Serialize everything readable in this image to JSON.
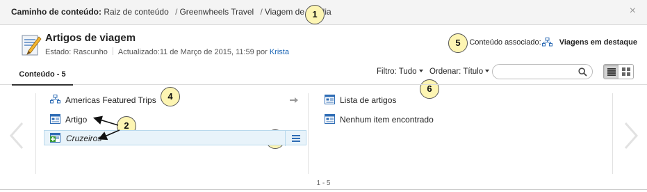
{
  "path": {
    "label": "Caminho de conteúdo:",
    "root": "Raiz de conteúdo",
    "segments": [
      "Greenwheels Travel",
      "Viagem de família"
    ],
    "separator": "/"
  },
  "close_label": "×",
  "callouts": [
    "1",
    "2",
    "3",
    "4",
    "5",
    "6"
  ],
  "header": {
    "title": "Artigos de viagem",
    "status": "Estado: Rascunho",
    "updated": "Actualizado:11 de Março de 2015, 11:59 por",
    "author": "Krista"
  },
  "associated": {
    "label": "Conteúdo associado:",
    "link": "Viagens em destaque"
  },
  "tabs": [
    {
      "label": "Conteúdo - 5"
    }
  ],
  "filters": {
    "filter_label": "Filtro: Tudo",
    "sort_label": "Ordenar: Título"
  },
  "search": {
    "placeholder": "",
    "value": ""
  },
  "left_list": [
    {
      "label": "Americas Featured Trips",
      "icon": "sitemap-icon"
    },
    {
      "label": "Artigo",
      "icon": "template-icon"
    },
    {
      "label": "Cruzeiros",
      "icon": "add-template-icon",
      "selected": true
    }
  ],
  "right_list": [
    {
      "label": "Lista de artigos",
      "icon": "template-icon"
    },
    {
      "label": "Nenhum item encontrado",
      "icon": "template-icon"
    }
  ],
  "pager": "1 - 5",
  "colors": {
    "accent": "#1a64b4",
    "selected_bg": "#e8f3fa",
    "callout_bg": "#fdf5b3"
  }
}
